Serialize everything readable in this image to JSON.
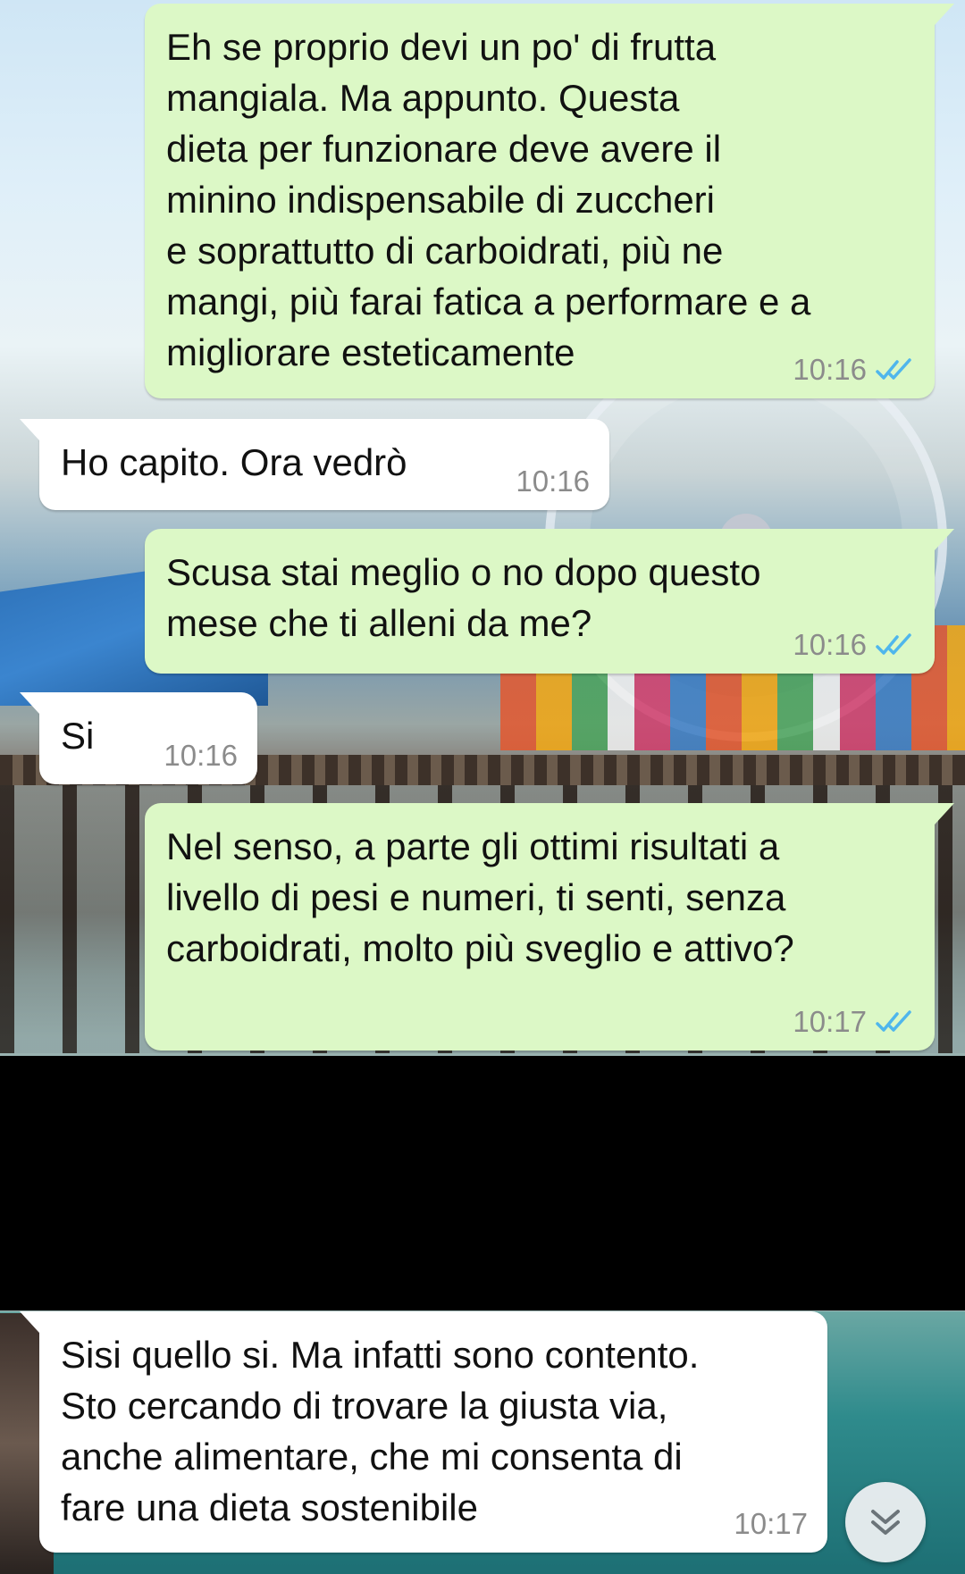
{
  "chat": {
    "messages": [
      {
        "direction": "outgoing",
        "text": "Eh se proprio devi un po' di frutta\nmangiala. Ma appunto. Questa\ndieta per funzionare deve avere il\nminino indispensabile di zuccheri\ne soprattutto di carboidrati, più ne\nmangi, più farai fatica a performare e a\nmigliorare esteticamente",
        "time": "10:16",
        "status": "read"
      },
      {
        "direction": "incoming",
        "text": "Ho capito. Ora vedrò",
        "time": "10:16"
      },
      {
        "direction": "outgoing",
        "text": "Scusa stai meglio o no dopo questo\nmese che ti alleni da me?",
        "time": "10:16",
        "status": "read"
      },
      {
        "direction": "incoming",
        "text": "Si",
        "time": "10:16"
      },
      {
        "direction": "outgoing",
        "text": "Nel senso, a parte gli ottimi risultati a\nlivello di pesi e numeri, ti senti, senza\ncarboidrati, molto più sveglio e attivo?",
        "time": "10:17",
        "status": "read"
      },
      {
        "direction": "incoming",
        "text": "Sisi quello si. Ma infatti sono contento.\nSto cercando di trovare la giusta via,\nanche alimentare, che mi consenta di\nfare una dieta sostenibile",
        "time": "10:17"
      }
    ]
  },
  "icons": {
    "read_receipt": "double-check-icon",
    "scroll_down": "double-chevron-down-icon"
  },
  "colors": {
    "outgoing_bubble": "#dcf8c6",
    "incoming_bubble": "#ffffff",
    "read_ticks": "#4fb6ec",
    "timestamp": "#8b8b8b",
    "redaction": "#000000"
  }
}
